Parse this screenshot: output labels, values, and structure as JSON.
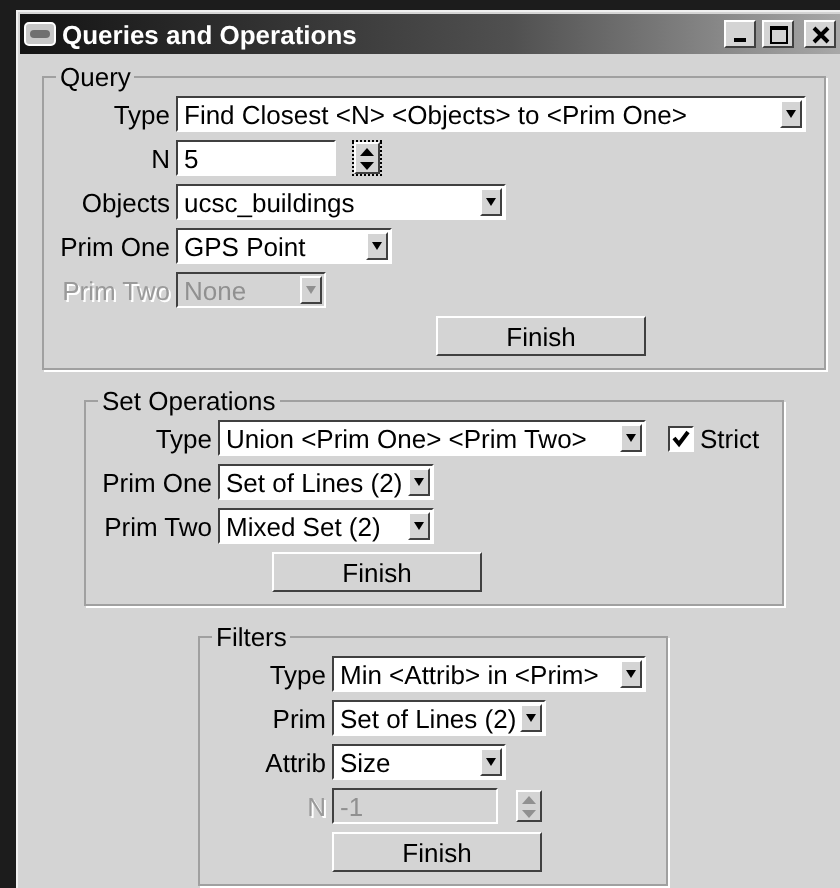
{
  "window": {
    "title": "Queries and Operations"
  },
  "groups": [
    {
      "title": "Query",
      "rows": [
        {
          "label": "Type",
          "kind": "combo",
          "value": "Find Closest <N> <Objects> to <Prim One>",
          "disabled": false
        },
        {
          "label": "N",
          "kind": "spin",
          "value": "5",
          "disabled": false
        },
        {
          "label": "Objects",
          "kind": "combo",
          "value": "ucsc_buildings",
          "disabled": false
        },
        {
          "label": "Prim One",
          "kind": "combo",
          "value": "GPS Point",
          "disabled": false
        },
        {
          "label": "Prim Two",
          "kind": "combo",
          "value": "None",
          "disabled": true
        }
      ],
      "button": "Finish"
    },
    {
      "title": "Set Operations",
      "rows": [
        {
          "label": "Type",
          "kind": "combo",
          "value": "Union <Prim One> <Prim Two>",
          "disabled": false,
          "checkbox": {
            "label": "Strict",
            "checked": true
          }
        },
        {
          "label": "Prim One",
          "kind": "combo",
          "value": "Set of Lines (2)",
          "disabled": false
        },
        {
          "label": "Prim Two",
          "kind": "combo",
          "value": "Mixed Set (2)",
          "disabled": false
        }
      ],
      "button": "Finish"
    },
    {
      "title": "Filters",
      "rows": [
        {
          "label": "Type",
          "kind": "combo",
          "value": "Min <Attrib> in <Prim>",
          "disabled": false
        },
        {
          "label": "Prim",
          "kind": "combo",
          "value": "Set of Lines (2)",
          "disabled": false
        },
        {
          "label": "Attrib",
          "kind": "combo",
          "value": "Size",
          "disabled": false
        },
        {
          "label": "N",
          "kind": "spin",
          "value": "-1",
          "disabled": true
        }
      ],
      "button": "Finish"
    }
  ]
}
